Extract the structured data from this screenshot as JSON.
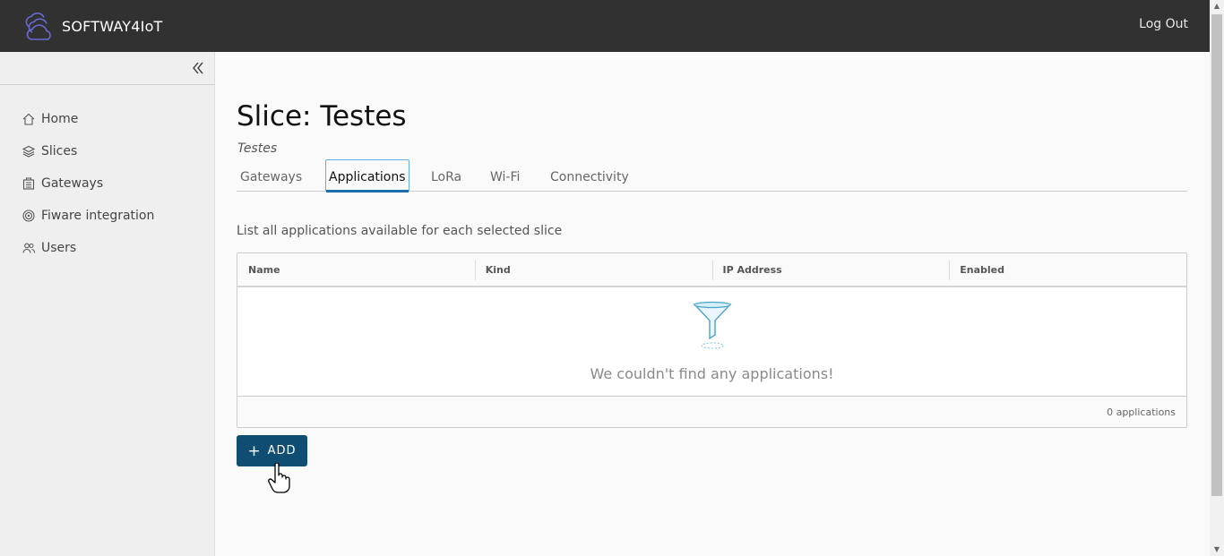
{
  "app": {
    "name": "SOFTWAY4IoT",
    "logout_label": "Log Out"
  },
  "sidebar": {
    "items": [
      {
        "label": "Home",
        "icon": "home-icon"
      },
      {
        "label": "Slices",
        "icon": "layers-icon"
      },
      {
        "label": "Gateways",
        "icon": "gateway-icon"
      },
      {
        "label": "Fiware integration",
        "icon": "target-icon"
      },
      {
        "label": "Users",
        "icon": "users-icon"
      }
    ]
  },
  "page": {
    "title": "Slice: Testes",
    "subtitle": "Testes",
    "tabs": [
      "Gateways",
      "Applications",
      "LoRa",
      "Wi-Fi",
      "Connectivity"
    ],
    "active_tab": "Applications",
    "description": "List all applications available for each selected slice"
  },
  "grid": {
    "columns": [
      "Name",
      "Kind",
      "IP Address",
      "Enabled"
    ],
    "rows": [],
    "empty_message": "We couldn't find any applications!",
    "footer_count": "0 applications"
  },
  "actions": {
    "add_label": "ADD",
    "add_icon": "plus-icon"
  },
  "colors": {
    "header": "#313131",
    "sidebar": "#efefef",
    "primary_button": "#0f4d72",
    "active_tab": "#1e6fb0",
    "brand_logo": "#5a58c8"
  }
}
